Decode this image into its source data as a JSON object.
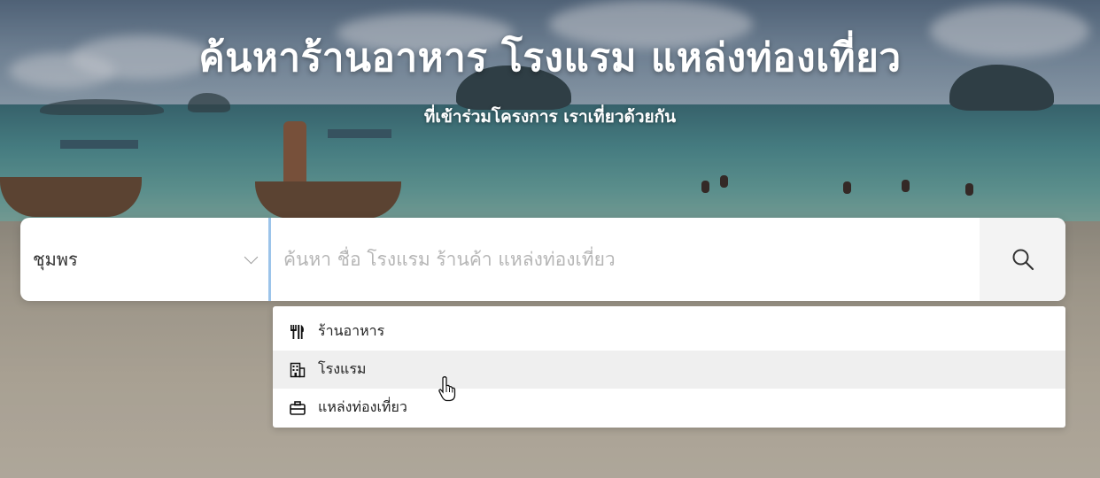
{
  "hero": {
    "title": "ค้นหาร้านอาหาร โรงแรม แหล่งท่องเที่ยว",
    "subtitle": "ที่เข้าร่วมโครงการ เราเที่ยวด้วยกัน"
  },
  "search": {
    "province_value": "ชุมพร",
    "query_value": "",
    "query_placeholder": "ค้นหา ชื่อ โรงแรม ร้านค้า แหล่งท่องเที่ยว",
    "button_icon": "search-icon"
  },
  "dropdown": {
    "items": [
      {
        "label": "ร้านอาหาร",
        "icon": "utensils-icon"
      },
      {
        "label": "โรงแรม",
        "icon": "building-icon",
        "hovered": true
      },
      {
        "label": "แหล่งท่องเที่ยว",
        "icon": "suitcase-icon"
      }
    ]
  },
  "colors": {
    "accent_border": "#9cc4ea",
    "hover_row": "#efefef"
  }
}
